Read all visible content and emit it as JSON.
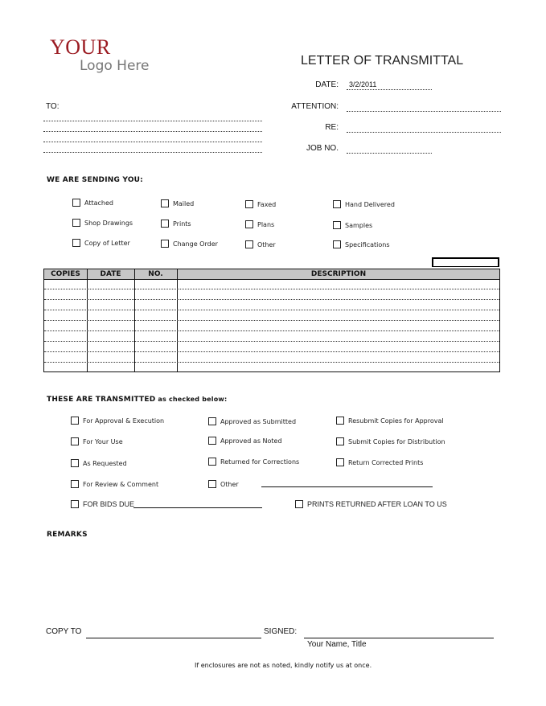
{
  "logo": {
    "line1": "YOUR",
    "line2": "Logo Here",
    "colors": {
      "line1": "#9b1b22",
      "line2": "#777777"
    }
  },
  "header": {
    "title": "LETTER OF TRANSMITTAL",
    "to_label": "TO:",
    "date_label": "DATE:",
    "date_value": "3/2/2011",
    "attention_label": "ATTENTION:",
    "attention_value": "",
    "re_label": "RE:",
    "re_value": "",
    "job_label": "JOB NO.",
    "job_value": ""
  },
  "sending": {
    "heading": "WE ARE SENDING YOU:",
    "items": [
      {
        "label": "Attached",
        "checked": false
      },
      {
        "label": "Mailed",
        "checked": false
      },
      {
        "label": "Faxed",
        "checked": false
      },
      {
        "label": "Hand Delivered",
        "checked": false
      },
      {
        "label": "Shop Drawings",
        "checked": false
      },
      {
        "label": "Prints",
        "checked": false
      },
      {
        "label": "Plans",
        "checked": false
      },
      {
        "label": "Samples",
        "checked": false
      },
      {
        "label": "Copy of Letter",
        "checked": false
      },
      {
        "label": "Change Order",
        "checked": false
      },
      {
        "label": "Other",
        "checked": false
      },
      {
        "label": "Specifications",
        "checked": false
      }
    ]
  },
  "table": {
    "columns": [
      "COPIES",
      "DATE",
      "NO.",
      "DESCRIPTION"
    ],
    "rows": [
      [
        "",
        "",
        "",
        ""
      ],
      [
        "",
        "",
        "",
        ""
      ],
      [
        "",
        "",
        "",
        ""
      ],
      [
        "",
        "",
        "",
        ""
      ],
      [
        "",
        "",
        "",
        ""
      ],
      [
        "",
        "",
        "",
        ""
      ],
      [
        "",
        "",
        "",
        ""
      ],
      [
        "",
        "",
        "",
        ""
      ],
      [
        "",
        "",
        "",
        ""
      ]
    ]
  },
  "transmitted": {
    "heading_bold": "THESE ARE TRANSMITTED",
    "heading_rest": " as checked below:",
    "items": [
      {
        "label": "For Approval & Execution",
        "checked": false
      },
      {
        "label": "Approved as Submitted",
        "checked": false
      },
      {
        "label": "Resubmit Copies for Approval",
        "checked": false
      },
      {
        "label": "For Your Use",
        "checked": false
      },
      {
        "label": "Approved as Noted",
        "checked": false
      },
      {
        "label": "Submit Copies for Distribution",
        "checked": false
      },
      {
        "label": "As Requested",
        "checked": false
      },
      {
        "label": "Returned for Corrections",
        "checked": false
      },
      {
        "label": "Return Corrected Prints",
        "checked": false
      },
      {
        "label": "For Review & Comment",
        "checked": false
      },
      {
        "label": "Other",
        "checked": false
      }
    ],
    "bids_due_label": "FOR BIDS DUE",
    "prints_returned_label": "PRINTS RETURNED AFTER LOAN TO US"
  },
  "remarks": {
    "heading": "REMARKS",
    "text": ""
  },
  "footer": {
    "copy_to_label": "COPY TO",
    "signed_label": "SIGNED:",
    "signer": "Your Name, Title",
    "notice": "If enclosures are not as noted, kindly notify us at once."
  }
}
